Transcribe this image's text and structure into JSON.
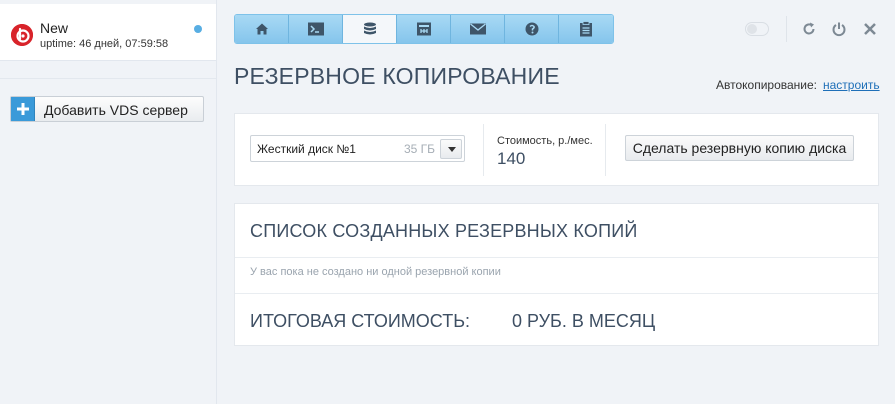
{
  "sidebar": {
    "server": {
      "name": "New",
      "uptime": "uptime: 46 дней, 07:59:58",
      "status_color": "#58aee3",
      "logo_icon": "yandex-cloud-logo"
    },
    "add_button_label": "Добавить VDS сервер",
    "add_button_icon": "plus-icon"
  },
  "tabs": [
    {
      "icon": "home-icon",
      "active": false
    },
    {
      "icon": "terminal-icon",
      "active": false
    },
    {
      "icon": "database-icon",
      "active": true
    },
    {
      "icon": "network-icon",
      "active": false
    },
    {
      "icon": "mail-icon",
      "active": false
    },
    {
      "icon": "support-icon",
      "active": false
    },
    {
      "icon": "clipboard-icon",
      "active": false
    }
  ],
  "toolbar": {
    "icons": [
      "toggle-icon",
      "refresh-icon",
      "power-icon",
      "close-icon"
    ]
  },
  "page": {
    "title": "РЕЗЕРВНОЕ КОПИРОВАНИЕ",
    "autocopy_label": "Автокопирование:",
    "autocopy_link": "настроить"
  },
  "backup_form": {
    "disk_select": {
      "value": "Жесткий диск №1",
      "size": "35 ГБ"
    },
    "cost_label": "Стоимость, р./мес.",
    "cost_value": "140",
    "make_backup_label": "Сделать резервную копию диска"
  },
  "backup_list": {
    "title": "СПИСОК СОЗДАННЫХ РЕЗЕРВНЫХ КОПИЙ",
    "empty_text": "У вас пока не создано ни одной резервной копии",
    "total_label": "ИТОГОВАЯ СТОИМОСТЬ:",
    "total_value": "0 РУБ. В МЕСЯЦ"
  },
  "colors": {
    "accent": "#3a9ad9",
    "tab_bg": "#94ceef",
    "heading": "#3e4f63",
    "link": "#1e6fb8"
  }
}
